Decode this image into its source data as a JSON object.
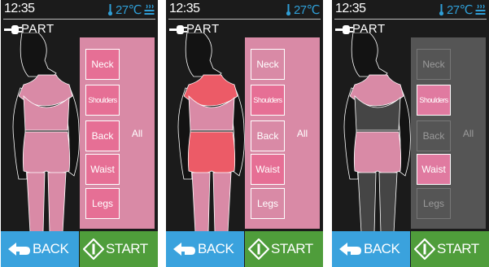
{
  "screens": [
    {
      "time": "12:35",
      "temperature": "27℃",
      "part_title": "PART",
      "parts": {
        "neck": "Neck",
        "shoulders": "Shoulders",
        "back": "Back",
        "waist": "Waist",
        "legs": "Legs",
        "all": "All"
      },
      "selected_parts": [
        "neck",
        "shoulders",
        "back",
        "waist",
        "legs",
        "all"
      ],
      "back_label": "BACK",
      "start_label": "START"
    },
    {
      "time": "12:35",
      "temperature": "27℃",
      "part_title": "PART",
      "parts": {
        "neck": "Neck",
        "shoulders": "Shoulders",
        "back": "Back",
        "waist": "Waist",
        "legs": "Legs",
        "all": "All"
      },
      "selected_parts": [
        "shoulders",
        "waist"
      ],
      "back_label": "BACK",
      "start_label": "START"
    },
    {
      "time": "12:35",
      "temperature": "27℃",
      "part_title": "PART",
      "parts": {
        "neck": "Neck",
        "shoulders": "Shoulders",
        "back": "Back",
        "waist": "Waist",
        "legs": "Legs",
        "all": "All"
      },
      "selected_parts": [
        "shoulders",
        "waist"
      ],
      "back_label": "BACK",
      "start_label": "START"
    }
  ],
  "colors": {
    "screen_bg": "#1b1b1b",
    "panel_pink": "#d98aa6",
    "panel_gray": "#555555",
    "selected_pink": "#e66f95",
    "highlight_red": "#ec5b67",
    "body_pink": "#d98aa6",
    "body_gray": "#454545",
    "temp_blue": "#2f9ed6",
    "back_blue": "#3aa2dd",
    "start_green": "#4f9d3b"
  },
  "icons": {
    "thermometer": "thermometer-icon",
    "heater": "heater-icon",
    "plug": "plug-icon",
    "back": "back-arrow-icon",
    "start": "start-diamond-icon"
  }
}
